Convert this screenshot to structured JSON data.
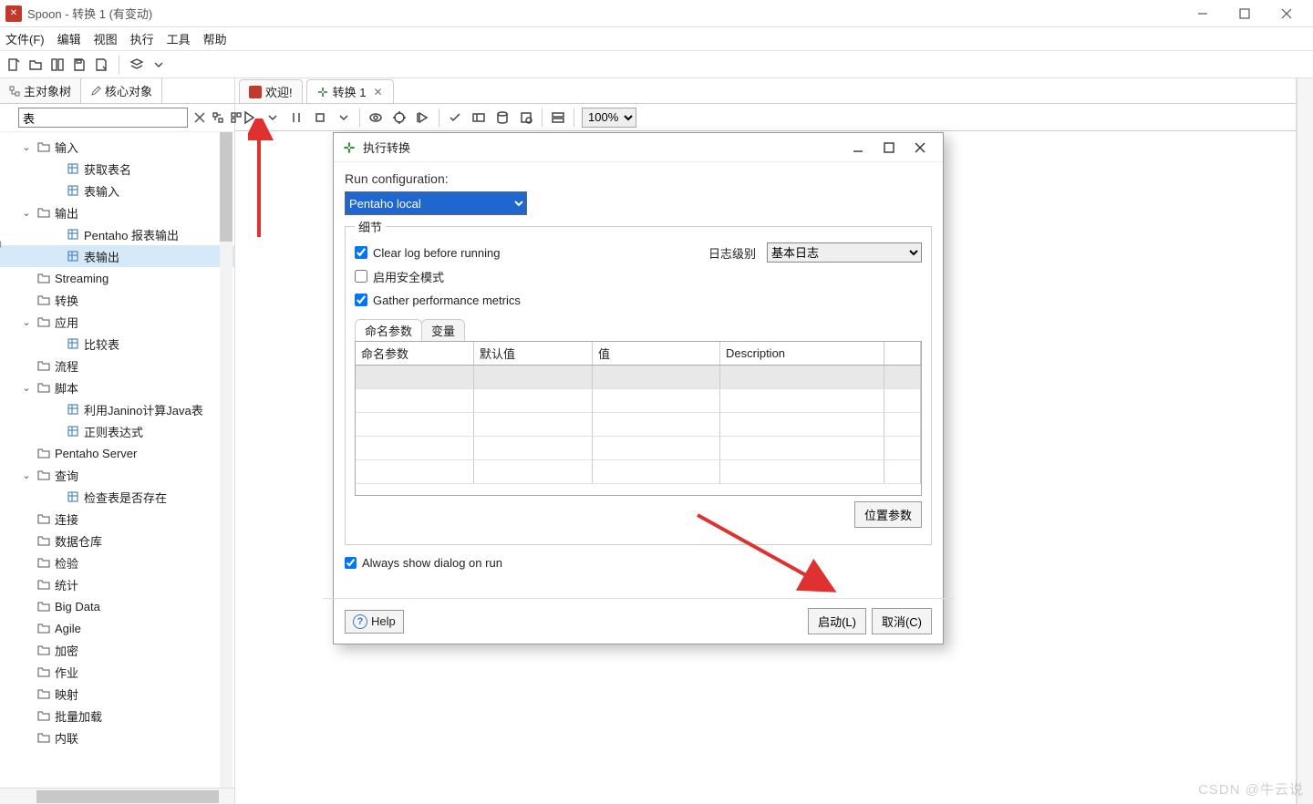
{
  "window": {
    "title": "Spoon - 转换 1 (有变动)"
  },
  "menubar": [
    "文件(F)",
    "编辑",
    "视图",
    "执行",
    "工具",
    "帮助"
  ],
  "left_tabs": {
    "main": "主对象树",
    "core": "核心对象"
  },
  "search": {
    "value": "表"
  },
  "tree": [
    {
      "depth": 1,
      "chev": "v",
      "type": "folder",
      "label": "输入"
    },
    {
      "depth": 2,
      "chev": "",
      "type": "item",
      "label": "获取表名"
    },
    {
      "depth": 2,
      "chev": "",
      "type": "item",
      "label": "表输入"
    },
    {
      "depth": 1,
      "chev": "v",
      "type": "folder",
      "label": "输出"
    },
    {
      "depth": 2,
      "chev": "",
      "type": "item",
      "label": "Pentaho 报表输出"
    },
    {
      "depth": 2,
      "chev": "",
      "type": "item",
      "label": "表输出",
      "selected": true
    },
    {
      "depth": 1,
      "chev": "",
      "type": "folder",
      "label": "Streaming"
    },
    {
      "depth": 1,
      "chev": "",
      "type": "folder",
      "label": "转换"
    },
    {
      "depth": 1,
      "chev": "v",
      "type": "folder",
      "label": "应用"
    },
    {
      "depth": 2,
      "chev": "",
      "type": "item",
      "label": "比较表"
    },
    {
      "depth": 1,
      "chev": "",
      "type": "folder",
      "label": "流程"
    },
    {
      "depth": 1,
      "chev": "v",
      "type": "folder",
      "label": "脚本"
    },
    {
      "depth": 2,
      "chev": "",
      "type": "item",
      "label": "利用Janino计算Java表"
    },
    {
      "depth": 2,
      "chev": "",
      "type": "item",
      "label": "正则表达式"
    },
    {
      "depth": 1,
      "chev": "",
      "type": "folder",
      "label": "Pentaho Server"
    },
    {
      "depth": 1,
      "chev": "v",
      "type": "folder",
      "label": "查询"
    },
    {
      "depth": 2,
      "chev": "",
      "type": "item",
      "label": "检查表是否存在"
    },
    {
      "depth": 1,
      "chev": "",
      "type": "folder",
      "label": "连接"
    },
    {
      "depth": 1,
      "chev": "",
      "type": "folder",
      "label": "数据仓库"
    },
    {
      "depth": 1,
      "chev": "",
      "type": "folder",
      "label": "检验"
    },
    {
      "depth": 1,
      "chev": "",
      "type": "folder",
      "label": "统计"
    },
    {
      "depth": 1,
      "chev": "",
      "type": "folder",
      "label": "Big Data"
    },
    {
      "depth": 1,
      "chev": "",
      "type": "folder",
      "label": "Agile"
    },
    {
      "depth": 1,
      "chev": "",
      "type": "folder",
      "label": "加密"
    },
    {
      "depth": 1,
      "chev": "",
      "type": "folder",
      "label": "作业"
    },
    {
      "depth": 1,
      "chev": "",
      "type": "folder",
      "label": "映射"
    },
    {
      "depth": 1,
      "chev": "",
      "type": "folder",
      "label": "批量加载"
    },
    {
      "depth": 1,
      "chev": "",
      "type": "folder",
      "label": "内联"
    }
  ],
  "doc_tabs": {
    "welcome": "欢迎!",
    "trans": "转换 1"
  },
  "zoom": "100%",
  "dialog": {
    "title": "执行转换",
    "run_cfg_label": "Run configuration:",
    "run_cfg_value": "Pentaho local",
    "details_legend": "细节",
    "clear_log": "Clear log before running",
    "safe_mode": "启用安全模式",
    "gather_metrics": "Gather performance metrics",
    "log_level_label": "日志级别",
    "log_level_value": "基本日志",
    "tab_named": "命名参数",
    "tab_vars": "变量",
    "col0": "命名参数",
    "col1": "默认值",
    "col2": "值",
    "col3": "Description",
    "pos_btn": "位置参数",
    "always_show": "Always show dialog on run",
    "help": "Help",
    "launch": "启动(L)",
    "cancel": "取消(C)"
  },
  "watermark": "CSDN @牛云说"
}
